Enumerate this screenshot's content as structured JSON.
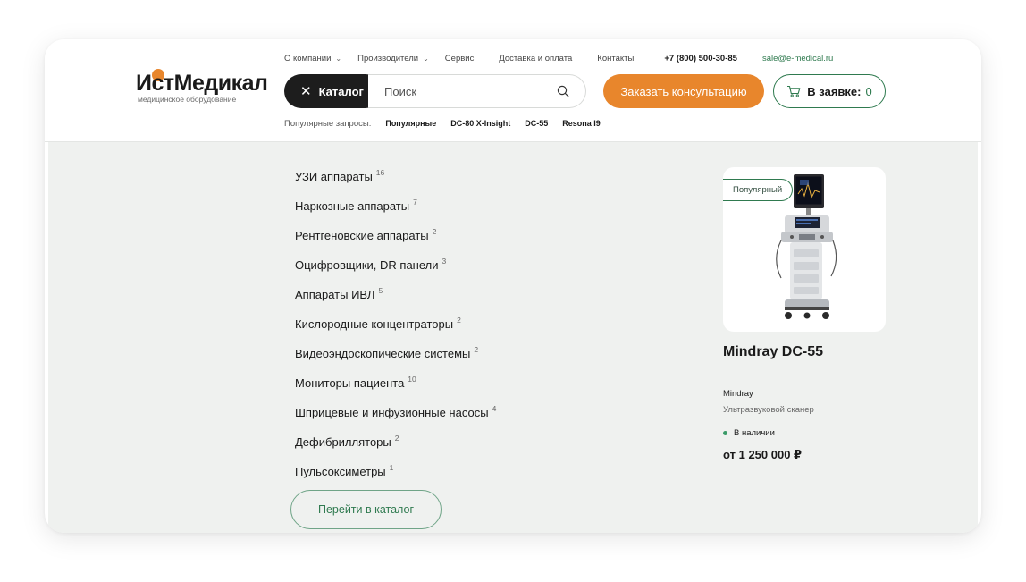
{
  "logo": {
    "text": "ИстМедикал",
    "subtitle": "медицинское оборудование"
  },
  "topnav": {
    "items": [
      {
        "label": "О компании",
        "dropdown": true
      },
      {
        "label": "Производители",
        "dropdown": true
      },
      {
        "label": "Сервис",
        "dropdown": false
      },
      {
        "label": "Доставка и оплата",
        "dropdown": false
      },
      {
        "label": "Контакты",
        "dropdown": false
      }
    ],
    "phone": "+7 (800) 500-30-85",
    "email": "sale@e-medical.ru"
  },
  "header": {
    "catalog_label": "Каталог",
    "search_placeholder": "Поиск",
    "consult_label": "Заказать консультацию",
    "cart_label": "В заявке:",
    "cart_count": "0"
  },
  "popular": {
    "label": "Популярные запросы:",
    "items": [
      "Популярные",
      "DC-80 X-Insight",
      "DC-55",
      "Resona I9"
    ]
  },
  "categories": [
    {
      "name": "УЗИ аппараты",
      "count": "16"
    },
    {
      "name": "Наркозные аппараты",
      "count": "7"
    },
    {
      "name": "Рентгеновские аппараты",
      "count": "2"
    },
    {
      "name": "Оцифровщики, DR панели",
      "count": "3"
    },
    {
      "name": "Аппараты ИВЛ",
      "count": "5"
    },
    {
      "name": "Кислородные концентраторы",
      "count": "2"
    },
    {
      "name": "Видеоэндоскопические системы",
      "count": "2"
    },
    {
      "name": "Мониторы пациента",
      "count": "10"
    },
    {
      "name": "Шприцевые и инфузионные насосы",
      "count": "4"
    },
    {
      "name": "Дефибрилляторы",
      "count": "2"
    },
    {
      "name": "Пульсоксиметры",
      "count": "1"
    }
  ],
  "goto_catalog_label": "Перейти в каталог",
  "product": {
    "badge": "Популярный",
    "title": "Mindray DC-55",
    "brand": "Mindray",
    "type": "Ультразвуковой сканер",
    "stock": "В наличии",
    "price": "от 1 250 000 ₽"
  },
  "colors": {
    "accent_orange": "#e8862c",
    "accent_green": "#2f7a4f",
    "dark": "#1d1d1d",
    "panel_bg": "#eff1ef"
  }
}
